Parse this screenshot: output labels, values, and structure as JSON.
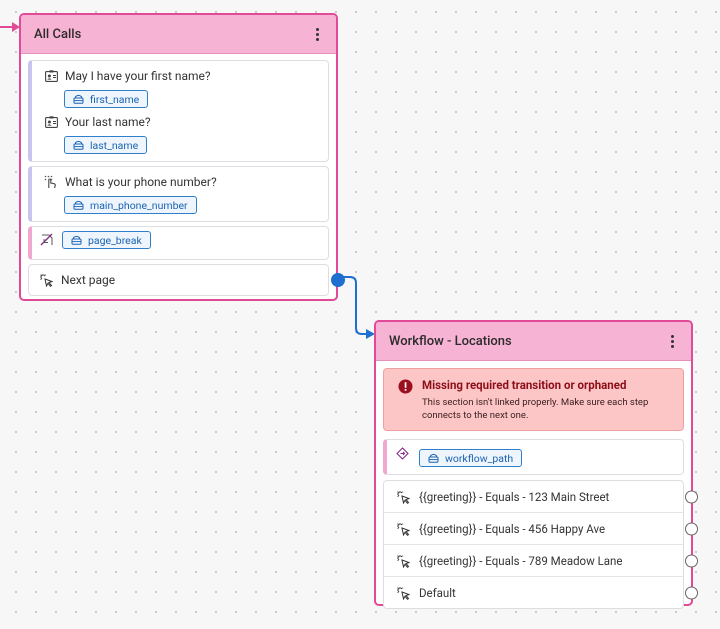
{
  "node_all_calls": {
    "title": "All Calls",
    "questions": [
      {
        "text": "May I have your first name?",
        "icon": "contact-card-icon",
        "variable": "first_name"
      },
      {
        "text": "Your last name?",
        "icon": "contact-card-icon",
        "variable": "last_name"
      }
    ],
    "phone": {
      "text": "What is your phone number?",
      "icon": "touch-dial-icon",
      "variable": "main_phone_number"
    },
    "page_break": {
      "icon": "page-break-icon",
      "variable": "page_break"
    },
    "next": {
      "label": "Next page",
      "icon": "click-pointer-icon"
    }
  },
  "node_workflow": {
    "title": "Workflow - Locations",
    "alert": {
      "title": "Missing required transition or orphaned",
      "text": "This section isn't linked properly. Make sure each step connects to the next one."
    },
    "path": {
      "icon": "decision-diamond-icon",
      "variable": "workflow_path"
    },
    "transitions": [
      "{{greeting}} - Equals - 123 Main Street",
      "{{greeting}} - Equals - 456 Happy Ave",
      "{{greeting}} - Equals - 789 Meadow Lane",
      "Default"
    ]
  },
  "colors": {
    "node_border": "#e04a96",
    "node_header": "#f7b3d4",
    "connector": "#1f6fd0",
    "alert_bg": "#fdc6c6",
    "alert_title": "#8b0f19",
    "chip": "#2f7fcb"
  }
}
